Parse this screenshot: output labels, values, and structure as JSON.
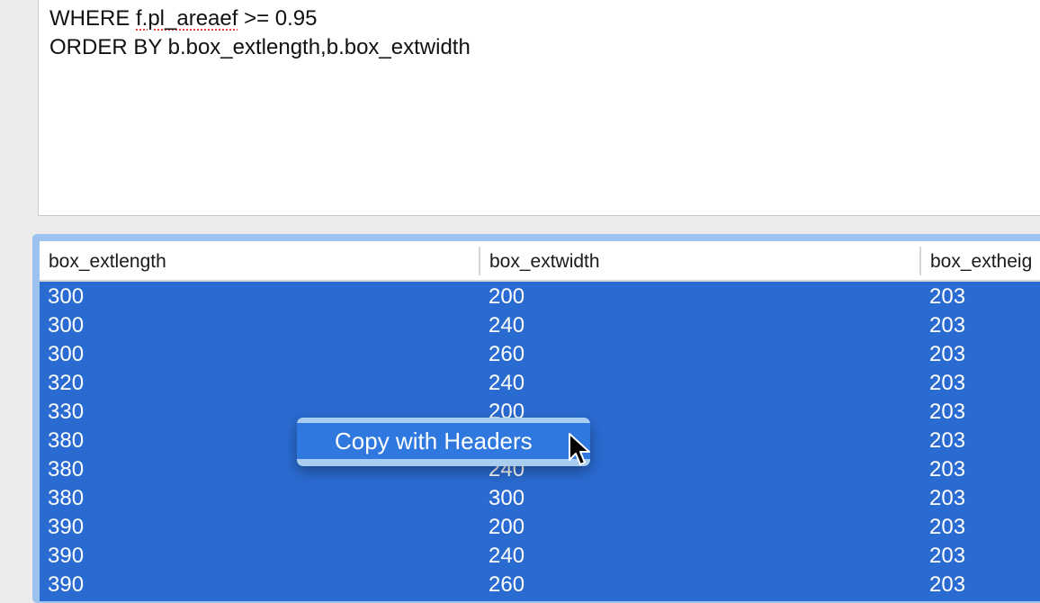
{
  "sql_editor": {
    "lines": [
      "      _                                      _",
      "WHERE f.pl_areaef >= 0.95",
      "ORDER BY b.box_extlength,b.box_extwidth"
    ],
    "line1_parts": {
      "keyword": "WHERE ",
      "misspelled": "f.pl_areaef",
      "rest": " >= 0.95"
    }
  },
  "results": {
    "columns": [
      "box_extlength",
      "box_extwidth",
      "box_extheig"
    ],
    "rows": [
      [
        "300",
        "200",
        "203"
      ],
      [
        "300",
        "240",
        "203"
      ],
      [
        "300",
        "260",
        "203"
      ],
      [
        "320",
        "240",
        "203"
      ],
      [
        "330",
        "200",
        "203"
      ],
      [
        "380",
        "",
        "203"
      ],
      [
        "380",
        "240",
        "203"
      ],
      [
        "380",
        "300",
        "203"
      ],
      [
        "390",
        "200",
        "203"
      ],
      [
        "390",
        "240",
        "203"
      ],
      [
        "390",
        "260",
        "203"
      ]
    ],
    "selection": "all-rows-selected"
  },
  "context_menu": {
    "items": [
      {
        "label": "Copy with Headers",
        "highlighted": true
      }
    ]
  },
  "colors": {
    "selection_bg": "#2a6bd1",
    "focus_ring": "#9cc2ee",
    "menu_bg": "#a9cdf0",
    "menu_highlight": "#2f78df",
    "spellcheck_underline": "#e0453a"
  },
  "cursor": {
    "type": "arrow-pointer-icon"
  }
}
